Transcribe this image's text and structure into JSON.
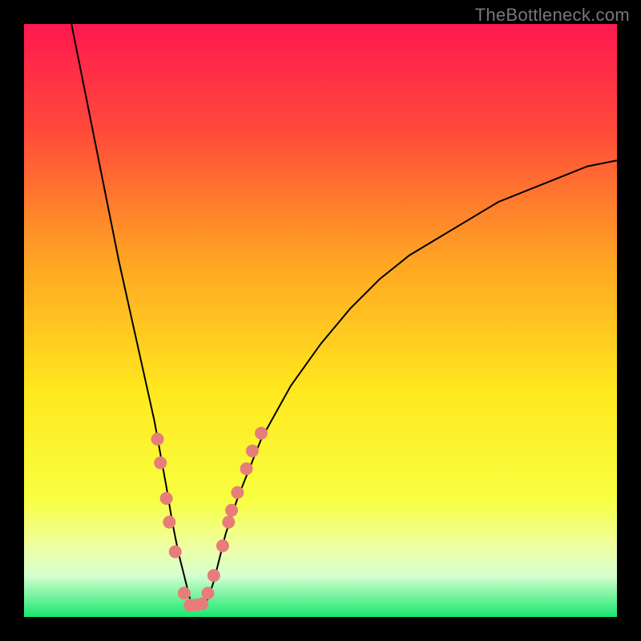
{
  "watermark": "TheBottleneck.com",
  "chart_data": {
    "type": "line",
    "title": "",
    "xlabel": "",
    "ylabel": "",
    "xlim": [
      0,
      100
    ],
    "ylim": [
      0,
      100
    ],
    "note": "Axes have no visible tick labels; values are estimated in percent of plot width/height. Curve is a V-shaped bottleneck curve with minimum near x≈28.",
    "curve": {
      "name": "bottleneck-curve",
      "color": "#000000",
      "x": [
        8,
        10,
        12,
        14,
        16,
        18,
        20,
        22,
        24,
        25,
        26,
        27,
        28,
        29,
        30,
        31,
        32,
        33,
        34,
        36,
        40,
        45,
        50,
        55,
        60,
        65,
        70,
        75,
        80,
        85,
        90,
        95,
        100
      ],
      "y": [
        100,
        90,
        80,
        70,
        60,
        51,
        42,
        33,
        22,
        16,
        11,
        7,
        3,
        2,
        2,
        3,
        6,
        10,
        14,
        20,
        30,
        39,
        46,
        52,
        57,
        61,
        64,
        67,
        70,
        72,
        74,
        76,
        77
      ]
    },
    "markers": {
      "name": "highlight-points",
      "color": "#e77d7a",
      "radius": 8,
      "points": [
        {
          "x": 22.5,
          "y": 30
        },
        {
          "x": 23.0,
          "y": 26
        },
        {
          "x": 24.0,
          "y": 20
        },
        {
          "x": 24.5,
          "y": 16
        },
        {
          "x": 25.5,
          "y": 11
        },
        {
          "x": 27.0,
          "y": 4
        },
        {
          "x": 28.0,
          "y": 2
        },
        {
          "x": 29.0,
          "y": 2
        },
        {
          "x": 30.0,
          "y": 2.2
        },
        {
          "x": 31.0,
          "y": 4
        },
        {
          "x": 32.0,
          "y": 7
        },
        {
          "x": 33.5,
          "y": 12
        },
        {
          "x": 34.5,
          "y": 16
        },
        {
          "x": 35.0,
          "y": 18
        },
        {
          "x": 36.0,
          "y": 21
        },
        {
          "x": 37.5,
          "y": 25
        },
        {
          "x": 38.5,
          "y": 28
        },
        {
          "x": 40.0,
          "y": 31
        }
      ]
    },
    "gradient": {
      "stops": [
        {
          "offset": 0,
          "color": "#ff1850"
        },
        {
          "offset": 18,
          "color": "#ff4a3a"
        },
        {
          "offset": 40,
          "color": "#ffa523"
        },
        {
          "offset": 62,
          "color": "#ffe81e"
        },
        {
          "offset": 80,
          "color": "#f8ff40"
        },
        {
          "offset": 88,
          "color": "#efffa0"
        },
        {
          "offset": 93,
          "color": "#d6ffd0"
        },
        {
          "offset": 100,
          "color": "#17e86e"
        }
      ]
    }
  }
}
